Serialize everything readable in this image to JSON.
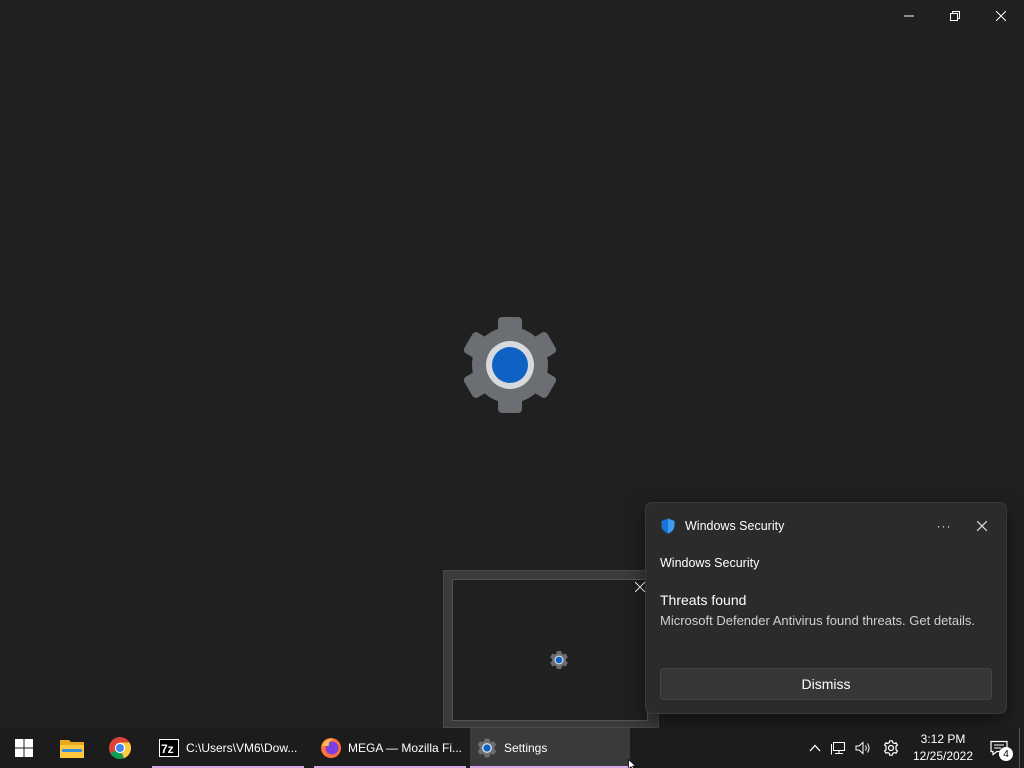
{
  "window": {
    "app_icon": "settings-gear-icon",
    "caption_buttons": [
      "minimize",
      "restore",
      "close"
    ]
  },
  "preview": {
    "icon": "settings-gear-icon"
  },
  "toast": {
    "app_name": "Windows Security",
    "app_icon": "shield-icon",
    "more_label": "···",
    "subtitle": "Windows Security",
    "title": "Threats found",
    "body": "Microsoft Defender Antivirus found threats. Get details.",
    "dismiss_label": "Dismiss"
  },
  "taskbar": {
    "apps": [
      {
        "label": "C:\\Users\\VM6\\Dow...",
        "icon": "7zip-icon"
      },
      {
        "label": "MEGA — Mozilla Fi...",
        "icon": "firefox-icon"
      },
      {
        "label": "Settings",
        "icon": "settings-gear-icon"
      }
    ],
    "clock": {
      "time": "3:12 PM",
      "date": "12/25/2022"
    },
    "notification_count": "4"
  },
  "colors": {
    "background": "#202020",
    "taskbar": "#1c1c1c",
    "accent_blue": "#0f62c4",
    "toast_bg": "#2b2b2b"
  }
}
